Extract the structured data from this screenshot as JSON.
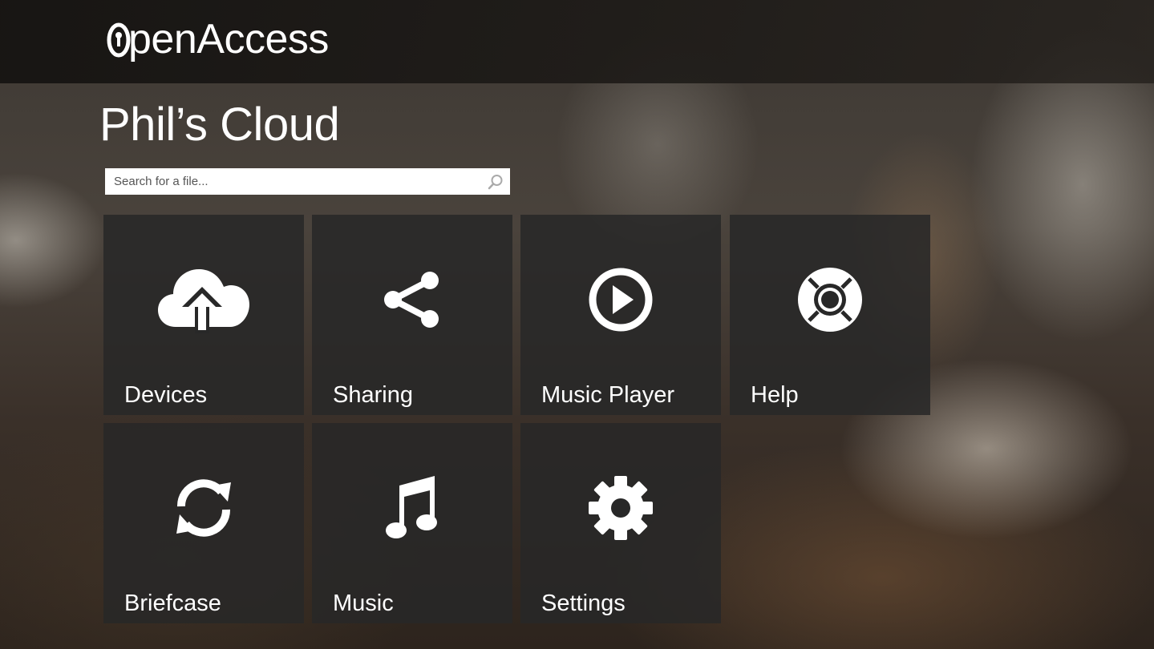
{
  "app": {
    "logo_text": "OpenAccess",
    "logo_part1": "pen",
    "logo_part2": "Access"
  },
  "page": {
    "title": "Phil’s Cloud"
  },
  "search": {
    "placeholder": "Search for a file...",
    "value": ""
  },
  "tiles": [
    {
      "label": "Devices",
      "icon": "cloud-upload-icon"
    },
    {
      "label": "Sharing",
      "icon": "share-icon"
    },
    {
      "label": "Music Player",
      "icon": "play-circle-icon"
    },
    {
      "label": "Help",
      "icon": "life-ring-icon"
    },
    {
      "label": "Briefcase",
      "icon": "sync-icon"
    },
    {
      "label": "Music",
      "icon": "music-note-icon"
    },
    {
      "label": "Settings",
      "icon": "gear-icon"
    }
  ],
  "colors": {
    "tile_bg": "#282828",
    "topbar_bg": "#1a1816",
    "text": "#ffffff"
  }
}
